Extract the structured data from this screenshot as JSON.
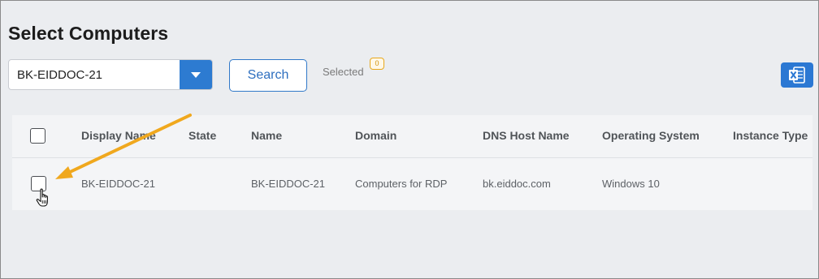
{
  "page": {
    "title": "Select Computers"
  },
  "toolbar": {
    "computer_select_value": "BK-EIDDOC-21",
    "search_label": "Search",
    "selected_label": "Selected",
    "selected_count": "0",
    "excel_icon": "excel-export-icon"
  },
  "table": {
    "columns": [
      "Display Name",
      "State",
      "Name",
      "Domain",
      "DNS Host Name",
      "Operating System",
      "Instance Type"
    ],
    "rows": [
      {
        "display_name": "BK-EIDDOC-21",
        "state": "",
        "name": "BK-EIDDOC-21",
        "domain": "Computers for RDP",
        "dns_host_name": "bk.eiddoc.com",
        "operating_system": "Windows 10",
        "instance_type": ""
      }
    ]
  },
  "colors": {
    "accent": "#2d7bd1",
    "annotation_arrow": "#f0a81e",
    "badge": "#e7a81c"
  }
}
